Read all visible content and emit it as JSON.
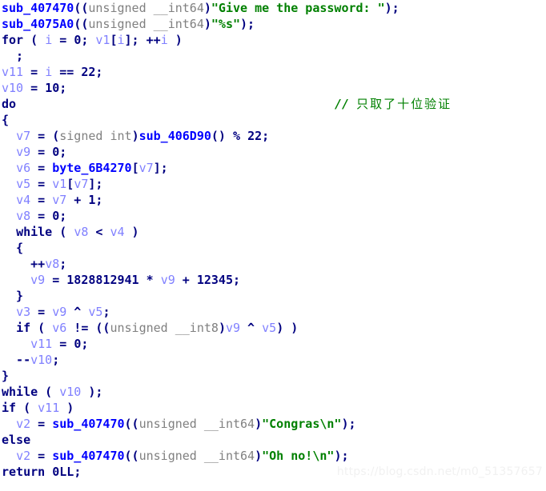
{
  "view": {
    "name": "ida-pseudocode-view",
    "background_color": "#ffffff"
  },
  "colors": {
    "function": "#0000ff",
    "keyword": "#000080",
    "variable": "#8080ff",
    "type": "#808080",
    "string": "#008000",
    "comment": "#008000",
    "number": "#000080",
    "watermark": "#f1f1f1"
  },
  "comment": {
    "marker": "// ",
    "text": "只取了十位验证"
  },
  "watermark": {
    "text": "https://blog.csdn.net/m0_51357657"
  },
  "lines": [
    {
      "n": 0,
      "tokens": [
        {
          "c": "func",
          "t": "sub_407470"
        },
        {
          "c": "punct",
          "t": "(("
        },
        {
          "c": "type",
          "t": "unsigned __int64"
        },
        {
          "c": "punct",
          "t": ")"
        },
        {
          "c": "string",
          "t": "\"Give me the password: \""
        },
        {
          "c": "punct",
          "t": ");"
        }
      ]
    },
    {
      "n": 1,
      "tokens": [
        {
          "c": "func",
          "t": "sub_4075A0"
        },
        {
          "c": "punct",
          "t": "(("
        },
        {
          "c": "type",
          "t": "unsigned __int64"
        },
        {
          "c": "punct",
          "t": ")"
        },
        {
          "c": "string",
          "t": "\"%s\""
        },
        {
          "c": "punct",
          "t": ");"
        }
      ]
    },
    {
      "n": 2,
      "tokens": [
        {
          "c": "keyword",
          "t": "for"
        },
        {
          "c": "punct",
          "t": " ( "
        },
        {
          "c": "var",
          "t": "i"
        },
        {
          "c": "punct",
          "t": " = "
        },
        {
          "c": "number",
          "t": "0"
        },
        {
          "c": "punct",
          "t": "; "
        },
        {
          "c": "var",
          "t": "v1"
        },
        {
          "c": "punct",
          "t": "["
        },
        {
          "c": "var",
          "t": "i"
        },
        {
          "c": "punct",
          "t": "]; ++"
        },
        {
          "c": "var",
          "t": "i"
        },
        {
          "c": "punct",
          "t": " )"
        }
      ]
    },
    {
      "n": 3,
      "tokens": [
        {
          "c": "punct",
          "t": "  ;"
        }
      ]
    },
    {
      "n": 4,
      "tokens": [
        {
          "c": "var",
          "t": "v11"
        },
        {
          "c": "punct",
          "t": " = "
        },
        {
          "c": "var",
          "t": "i"
        },
        {
          "c": "punct",
          "t": " == "
        },
        {
          "c": "number",
          "t": "22"
        },
        {
          "c": "punct",
          "t": ";"
        }
      ]
    },
    {
      "n": 5,
      "tokens": [
        {
          "c": "var",
          "t": "v10"
        },
        {
          "c": "punct",
          "t": " = "
        },
        {
          "c": "number",
          "t": "10"
        },
        {
          "c": "punct",
          "t": ";"
        }
      ]
    },
    {
      "n": 6,
      "comment": true,
      "tokens": [
        {
          "c": "keyword",
          "t": "do"
        }
      ]
    },
    {
      "n": 7,
      "tokens": [
        {
          "c": "punct",
          "t": "{"
        }
      ]
    },
    {
      "n": 8,
      "tokens": [
        {
          "c": "punct",
          "t": "  "
        },
        {
          "c": "var",
          "t": "v7"
        },
        {
          "c": "punct",
          "t": " = ("
        },
        {
          "c": "type",
          "t": "signed int"
        },
        {
          "c": "punct",
          "t": ")"
        },
        {
          "c": "func",
          "t": "sub_406D90"
        },
        {
          "c": "punct",
          "t": "() % "
        },
        {
          "c": "number",
          "t": "22"
        },
        {
          "c": "punct",
          "t": ";"
        }
      ]
    },
    {
      "n": 9,
      "tokens": [
        {
          "c": "punct",
          "t": "  "
        },
        {
          "c": "var",
          "t": "v9"
        },
        {
          "c": "punct",
          "t": " = "
        },
        {
          "c": "number",
          "t": "0"
        },
        {
          "c": "punct",
          "t": ";"
        }
      ]
    },
    {
      "n": 10,
      "tokens": [
        {
          "c": "punct",
          "t": "  "
        },
        {
          "c": "var",
          "t": "v6"
        },
        {
          "c": "punct",
          "t": " = "
        },
        {
          "c": "global",
          "t": "byte_6B4270"
        },
        {
          "c": "punct",
          "t": "["
        },
        {
          "c": "var",
          "t": "v7"
        },
        {
          "c": "punct",
          "t": "];"
        }
      ]
    },
    {
      "n": 11,
      "tokens": [
        {
          "c": "punct",
          "t": "  "
        },
        {
          "c": "var",
          "t": "v5"
        },
        {
          "c": "punct",
          "t": " = "
        },
        {
          "c": "var",
          "t": "v1"
        },
        {
          "c": "punct",
          "t": "["
        },
        {
          "c": "var",
          "t": "v7"
        },
        {
          "c": "punct",
          "t": "];"
        }
      ]
    },
    {
      "n": 12,
      "tokens": [
        {
          "c": "punct",
          "t": "  "
        },
        {
          "c": "var",
          "t": "v4"
        },
        {
          "c": "punct",
          "t": " = "
        },
        {
          "c": "var",
          "t": "v7"
        },
        {
          "c": "punct",
          "t": " + "
        },
        {
          "c": "number",
          "t": "1"
        },
        {
          "c": "punct",
          "t": ";"
        }
      ]
    },
    {
      "n": 13,
      "tokens": [
        {
          "c": "punct",
          "t": "  "
        },
        {
          "c": "var",
          "t": "v8"
        },
        {
          "c": "punct",
          "t": " = "
        },
        {
          "c": "number",
          "t": "0"
        },
        {
          "c": "punct",
          "t": ";"
        }
      ]
    },
    {
      "n": 14,
      "tokens": [
        {
          "c": "punct",
          "t": "  "
        },
        {
          "c": "keyword",
          "t": "while"
        },
        {
          "c": "punct",
          "t": " ( "
        },
        {
          "c": "var",
          "t": "v8"
        },
        {
          "c": "punct",
          "t": " < "
        },
        {
          "c": "var",
          "t": "v4"
        },
        {
          "c": "punct",
          "t": " )"
        }
      ]
    },
    {
      "n": 15,
      "tokens": [
        {
          "c": "punct",
          "t": "  {"
        }
      ]
    },
    {
      "n": 16,
      "tokens": [
        {
          "c": "punct",
          "t": "    ++"
        },
        {
          "c": "var",
          "t": "v8"
        },
        {
          "c": "punct",
          "t": ";"
        }
      ]
    },
    {
      "n": 17,
      "tokens": [
        {
          "c": "punct",
          "t": "    "
        },
        {
          "c": "var",
          "t": "v9"
        },
        {
          "c": "punct",
          "t": " = "
        },
        {
          "c": "number",
          "t": "1828812941"
        },
        {
          "c": "punct",
          "t": " * "
        },
        {
          "c": "var",
          "t": "v9"
        },
        {
          "c": "punct",
          "t": " + "
        },
        {
          "c": "number",
          "t": "12345"
        },
        {
          "c": "punct",
          "t": ";"
        }
      ]
    },
    {
      "n": 18,
      "tokens": [
        {
          "c": "punct",
          "t": "  }"
        }
      ]
    },
    {
      "n": 19,
      "tokens": [
        {
          "c": "punct",
          "t": "  "
        },
        {
          "c": "var",
          "t": "v3"
        },
        {
          "c": "punct",
          "t": " = "
        },
        {
          "c": "var",
          "t": "v9"
        },
        {
          "c": "punct",
          "t": " ^ "
        },
        {
          "c": "var",
          "t": "v5"
        },
        {
          "c": "punct",
          "t": ";"
        }
      ]
    },
    {
      "n": 20,
      "tokens": [
        {
          "c": "punct",
          "t": "  "
        },
        {
          "c": "keyword",
          "t": "if"
        },
        {
          "c": "punct",
          "t": " ( "
        },
        {
          "c": "var",
          "t": "v6"
        },
        {
          "c": "punct",
          "t": " != (("
        },
        {
          "c": "type",
          "t": "unsigned __int8"
        },
        {
          "c": "punct",
          "t": ")"
        },
        {
          "c": "var",
          "t": "v9"
        },
        {
          "c": "punct",
          "t": " ^ "
        },
        {
          "c": "var",
          "t": "v5"
        },
        {
          "c": "punct",
          "t": ") )"
        }
      ]
    },
    {
      "n": 21,
      "tokens": [
        {
          "c": "punct",
          "t": "    "
        },
        {
          "c": "var",
          "t": "v11"
        },
        {
          "c": "punct",
          "t": " = "
        },
        {
          "c": "number",
          "t": "0"
        },
        {
          "c": "punct",
          "t": ";"
        }
      ]
    },
    {
      "n": 22,
      "tokens": [
        {
          "c": "punct",
          "t": "  --"
        },
        {
          "c": "var",
          "t": "v10"
        },
        {
          "c": "punct",
          "t": ";"
        }
      ]
    },
    {
      "n": 23,
      "tokens": [
        {
          "c": "punct",
          "t": "}"
        }
      ]
    },
    {
      "n": 24,
      "tokens": [
        {
          "c": "keyword",
          "t": "while"
        },
        {
          "c": "punct",
          "t": " ( "
        },
        {
          "c": "var",
          "t": "v10"
        },
        {
          "c": "punct",
          "t": " );"
        }
      ]
    },
    {
      "n": 25,
      "tokens": [
        {
          "c": "keyword",
          "t": "if"
        },
        {
          "c": "punct",
          "t": " ( "
        },
        {
          "c": "var",
          "t": "v11"
        },
        {
          "c": "punct",
          "t": " )"
        }
      ]
    },
    {
      "n": 26,
      "tokens": [
        {
          "c": "punct",
          "t": "  "
        },
        {
          "c": "var",
          "t": "v2"
        },
        {
          "c": "punct",
          "t": " = "
        },
        {
          "c": "func",
          "t": "sub_407470"
        },
        {
          "c": "punct",
          "t": "(("
        },
        {
          "c": "type",
          "t": "unsigned __int64"
        },
        {
          "c": "punct",
          "t": ")"
        },
        {
          "c": "string",
          "t": "\"Congras\\n\""
        },
        {
          "c": "punct",
          "t": ");"
        }
      ]
    },
    {
      "n": 27,
      "tokens": [
        {
          "c": "keyword",
          "t": "else"
        }
      ]
    },
    {
      "n": 28,
      "tokens": [
        {
          "c": "punct",
          "t": "  "
        },
        {
          "c": "var",
          "t": "v2"
        },
        {
          "c": "punct",
          "t": " = "
        },
        {
          "c": "func",
          "t": "sub_407470"
        },
        {
          "c": "punct",
          "t": "(("
        },
        {
          "c": "type",
          "t": "unsigned __int64"
        },
        {
          "c": "punct",
          "t": ")"
        },
        {
          "c": "string",
          "t": "\"Oh no!\\n\""
        },
        {
          "c": "punct",
          "t": ");"
        }
      ]
    },
    {
      "n": 29,
      "tokens": [
        {
          "c": "keyword",
          "t": "return"
        },
        {
          "c": "punct",
          "t": " "
        },
        {
          "c": "number",
          "t": "0LL"
        },
        {
          "c": "punct",
          "t": ";"
        }
      ]
    }
  ]
}
